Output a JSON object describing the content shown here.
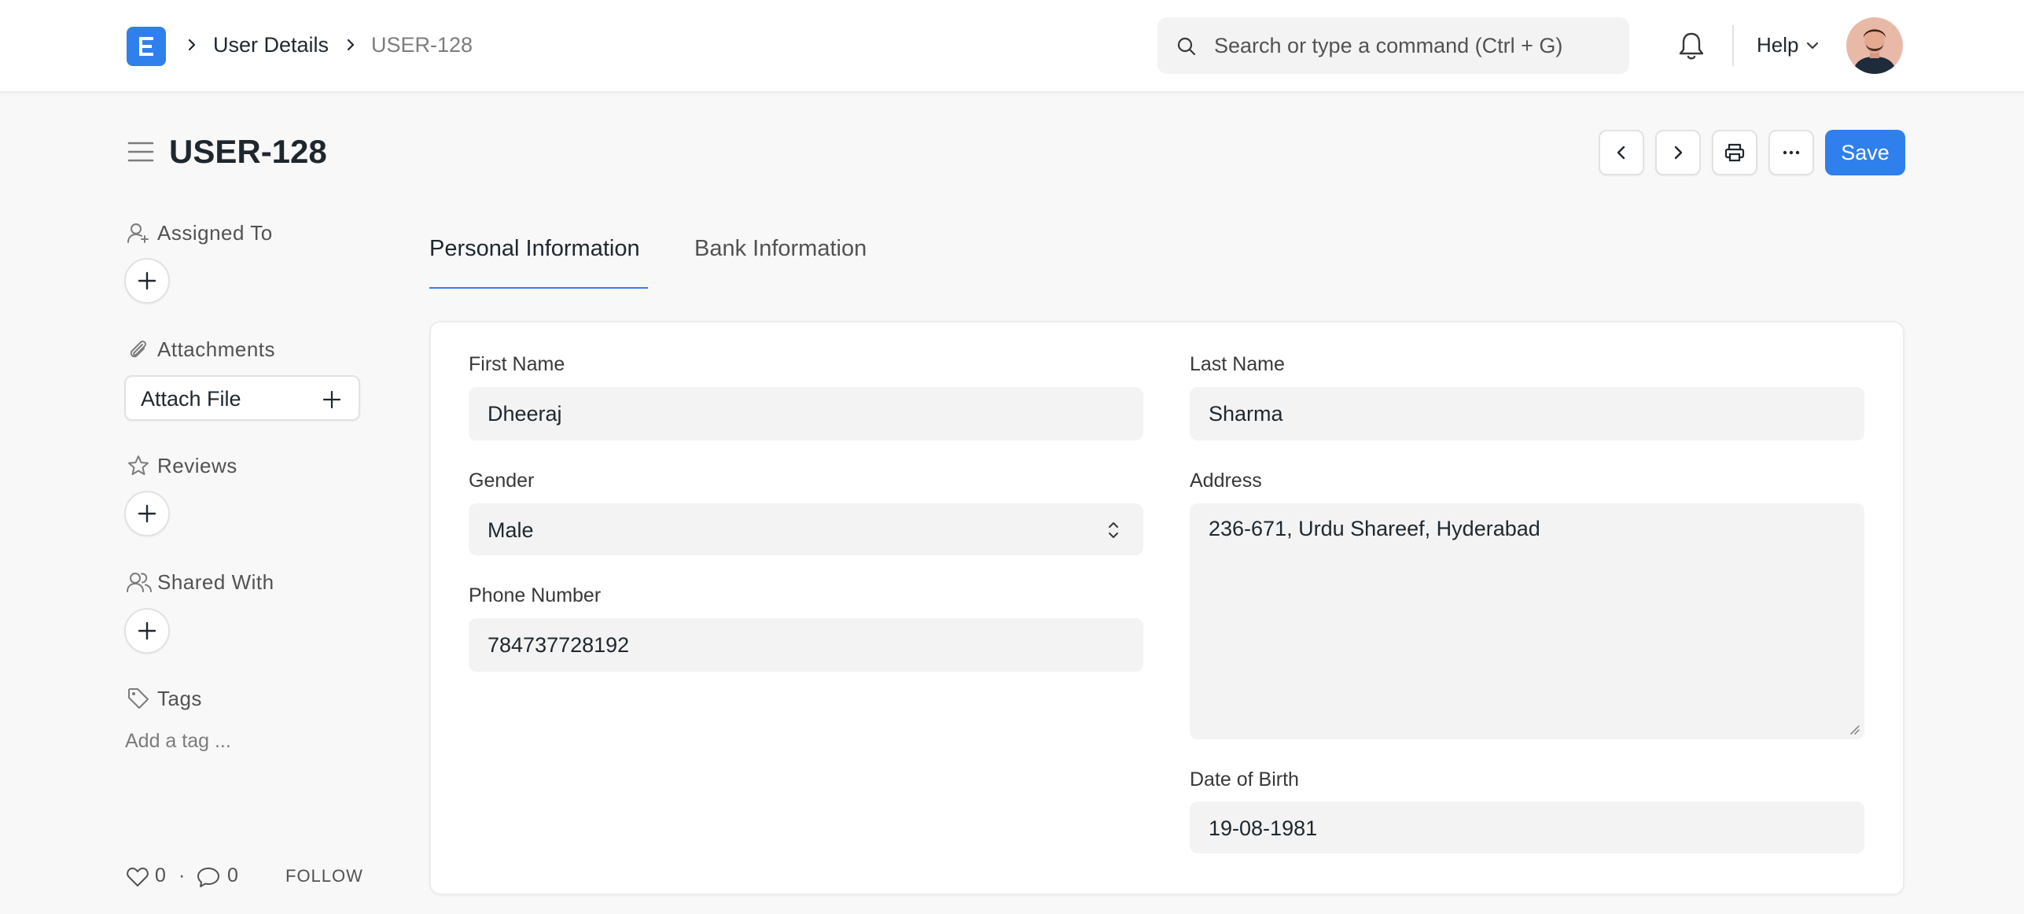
{
  "navbar": {
    "logo_letter": "E",
    "breadcrumbs": [
      "User Details",
      "USER-128"
    ],
    "search_placeholder": "Search or type a command (Ctrl + G)",
    "help_label": "Help"
  },
  "page": {
    "title": "USER-128",
    "save_label": "Save",
    "accent_color": "#2f80ed"
  },
  "sidebar": {
    "assigned_to": "Assigned To",
    "attachments": "Attachments",
    "attach_file": "Attach File",
    "reviews": "Reviews",
    "shared_with": "Shared With",
    "tags": "Tags",
    "add_tag": "Add a tag ...",
    "likes": "0",
    "separator": "·",
    "comments": "0",
    "follow": "FOLLOW"
  },
  "tabs": [
    {
      "label": "Personal Information",
      "active": true
    },
    {
      "label": "Bank Information",
      "active": false
    }
  ],
  "form": {
    "first_name": {
      "label": "First Name",
      "value": "Dheeraj"
    },
    "last_name": {
      "label": "Last Name",
      "value": "Sharma"
    },
    "gender": {
      "label": "Gender",
      "value": "Male"
    },
    "address": {
      "label": "Address",
      "value": "236-671, Urdu Shareef, Hyderabad"
    },
    "phone": {
      "label": "Phone Number",
      "value": "784737728192"
    },
    "dob": {
      "label": "Date of Birth",
      "value": "19-08-1981"
    }
  }
}
